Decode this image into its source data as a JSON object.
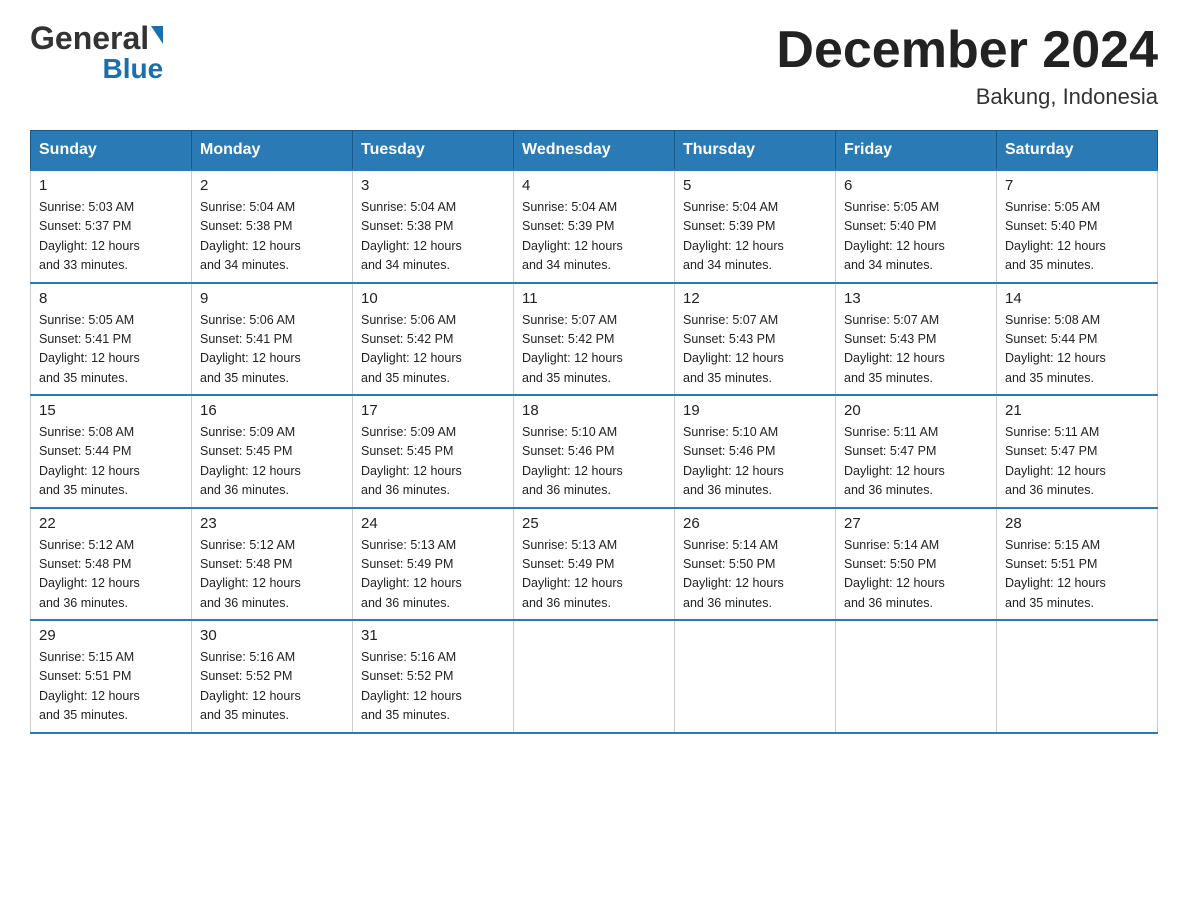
{
  "header": {
    "logo_general": "General",
    "logo_blue": "Blue",
    "title": "December 2024",
    "subtitle": "Bakung, Indonesia"
  },
  "days_of_week": [
    "Sunday",
    "Monday",
    "Tuesday",
    "Wednesday",
    "Thursday",
    "Friday",
    "Saturday"
  ],
  "weeks": [
    [
      {
        "day": "1",
        "sunrise": "5:03 AM",
        "sunset": "5:37 PM",
        "daylight": "12 hours and 33 minutes."
      },
      {
        "day": "2",
        "sunrise": "5:04 AM",
        "sunset": "5:38 PM",
        "daylight": "12 hours and 34 minutes."
      },
      {
        "day": "3",
        "sunrise": "5:04 AM",
        "sunset": "5:38 PM",
        "daylight": "12 hours and 34 minutes."
      },
      {
        "day": "4",
        "sunrise": "5:04 AM",
        "sunset": "5:39 PM",
        "daylight": "12 hours and 34 minutes."
      },
      {
        "day": "5",
        "sunrise": "5:04 AM",
        "sunset": "5:39 PM",
        "daylight": "12 hours and 34 minutes."
      },
      {
        "day": "6",
        "sunrise": "5:05 AM",
        "sunset": "5:40 PM",
        "daylight": "12 hours and 34 minutes."
      },
      {
        "day": "7",
        "sunrise": "5:05 AM",
        "sunset": "5:40 PM",
        "daylight": "12 hours and 35 minutes."
      }
    ],
    [
      {
        "day": "8",
        "sunrise": "5:05 AM",
        "sunset": "5:41 PM",
        "daylight": "12 hours and 35 minutes."
      },
      {
        "day": "9",
        "sunrise": "5:06 AM",
        "sunset": "5:41 PM",
        "daylight": "12 hours and 35 minutes."
      },
      {
        "day": "10",
        "sunrise": "5:06 AM",
        "sunset": "5:42 PM",
        "daylight": "12 hours and 35 minutes."
      },
      {
        "day": "11",
        "sunrise": "5:07 AM",
        "sunset": "5:42 PM",
        "daylight": "12 hours and 35 minutes."
      },
      {
        "day": "12",
        "sunrise": "5:07 AM",
        "sunset": "5:43 PM",
        "daylight": "12 hours and 35 minutes."
      },
      {
        "day": "13",
        "sunrise": "5:07 AM",
        "sunset": "5:43 PM",
        "daylight": "12 hours and 35 minutes."
      },
      {
        "day": "14",
        "sunrise": "5:08 AM",
        "sunset": "5:44 PM",
        "daylight": "12 hours and 35 minutes."
      }
    ],
    [
      {
        "day": "15",
        "sunrise": "5:08 AM",
        "sunset": "5:44 PM",
        "daylight": "12 hours and 35 minutes."
      },
      {
        "day": "16",
        "sunrise": "5:09 AM",
        "sunset": "5:45 PM",
        "daylight": "12 hours and 36 minutes."
      },
      {
        "day": "17",
        "sunrise": "5:09 AM",
        "sunset": "5:45 PM",
        "daylight": "12 hours and 36 minutes."
      },
      {
        "day": "18",
        "sunrise": "5:10 AM",
        "sunset": "5:46 PM",
        "daylight": "12 hours and 36 minutes."
      },
      {
        "day": "19",
        "sunrise": "5:10 AM",
        "sunset": "5:46 PM",
        "daylight": "12 hours and 36 minutes."
      },
      {
        "day": "20",
        "sunrise": "5:11 AM",
        "sunset": "5:47 PM",
        "daylight": "12 hours and 36 minutes."
      },
      {
        "day": "21",
        "sunrise": "5:11 AM",
        "sunset": "5:47 PM",
        "daylight": "12 hours and 36 minutes."
      }
    ],
    [
      {
        "day": "22",
        "sunrise": "5:12 AM",
        "sunset": "5:48 PM",
        "daylight": "12 hours and 36 minutes."
      },
      {
        "day": "23",
        "sunrise": "5:12 AM",
        "sunset": "5:48 PM",
        "daylight": "12 hours and 36 minutes."
      },
      {
        "day": "24",
        "sunrise": "5:13 AM",
        "sunset": "5:49 PM",
        "daylight": "12 hours and 36 minutes."
      },
      {
        "day": "25",
        "sunrise": "5:13 AM",
        "sunset": "5:49 PM",
        "daylight": "12 hours and 36 minutes."
      },
      {
        "day": "26",
        "sunrise": "5:14 AM",
        "sunset": "5:50 PM",
        "daylight": "12 hours and 36 minutes."
      },
      {
        "day": "27",
        "sunrise": "5:14 AM",
        "sunset": "5:50 PM",
        "daylight": "12 hours and 36 minutes."
      },
      {
        "day": "28",
        "sunrise": "5:15 AM",
        "sunset": "5:51 PM",
        "daylight": "12 hours and 35 minutes."
      }
    ],
    [
      {
        "day": "29",
        "sunrise": "5:15 AM",
        "sunset": "5:51 PM",
        "daylight": "12 hours and 35 minutes."
      },
      {
        "day": "30",
        "sunrise": "5:16 AM",
        "sunset": "5:52 PM",
        "daylight": "12 hours and 35 minutes."
      },
      {
        "day": "31",
        "sunrise": "5:16 AM",
        "sunset": "5:52 PM",
        "daylight": "12 hours and 35 minutes."
      },
      null,
      null,
      null,
      null
    ]
  ]
}
